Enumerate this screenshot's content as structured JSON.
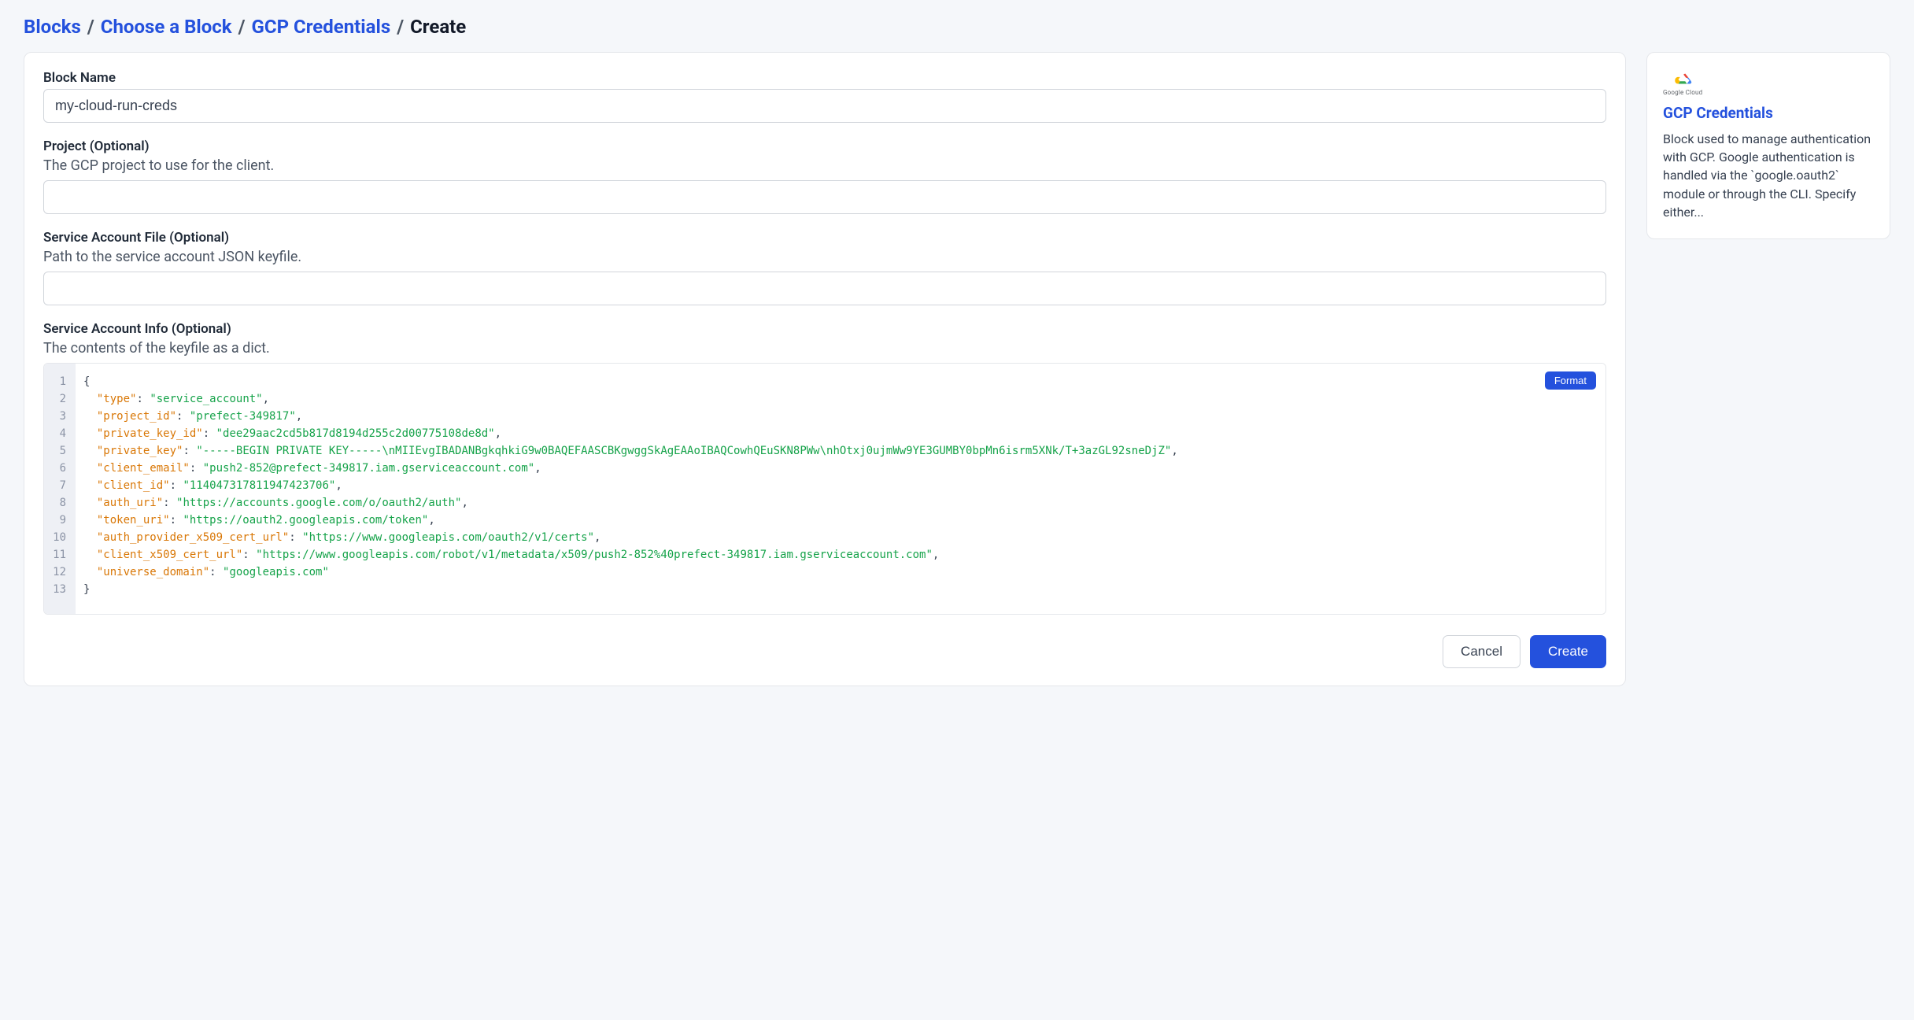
{
  "breadcrumb": {
    "blocks": "Blocks",
    "choose": "Choose a Block",
    "gcp": "GCP Credentials",
    "create": "Create"
  },
  "form": {
    "block_name": {
      "label": "Block Name",
      "value": "my-cloud-run-creds"
    },
    "project": {
      "label": "Project (Optional)",
      "desc": "The GCP project to use for the client.",
      "value": ""
    },
    "service_account_file": {
      "label": "Service Account File (Optional)",
      "desc": "Path to the service account JSON keyfile.",
      "value": ""
    },
    "service_account_info": {
      "label": "Service Account Info (Optional)",
      "desc": "The contents of the keyfile as a dict.",
      "format_button": "Format",
      "json": {
        "type": "service_account",
        "project_id": "prefect-349817",
        "private_key_id": "dee29aac2cd5b817d8194d255c2d00775108de8d",
        "private_key": "-----BEGIN PRIVATE KEY-----\\nMIIEvgIBADANBgkqhkiG9w0BAQEFAASCBKgwggSkAgEAAoIBAQCowhQEuSKN8PWw\\nhOtxj0ujmWw9YE3GUMBY0bpMn6isrm5XNk/T+3azGL92sneDjZ",
        "client_email": "push2-852@prefect-349817.iam.gserviceaccount.com",
        "client_id": "114047317811947423706",
        "auth_uri": "https://accounts.google.com/o/oauth2/auth",
        "token_uri": "https://oauth2.googleapis.com/token",
        "auth_provider_x509_cert_url": "https://www.googleapis.com/oauth2/v1/certs",
        "client_x509_cert_url": "https://www.googleapis.com/robot/v1/metadata/x509/push2-852%40prefect-349817.iam.gserviceaccount.com",
        "universe_domain": "googleapis.com"
      }
    }
  },
  "actions": {
    "cancel": "Cancel",
    "create": "Create"
  },
  "sidebar": {
    "logo_text": "Google Cloud",
    "title": "GCP Credentials",
    "description": "Block used to manage authentication with GCP. Google authentication is handled via the `google.oauth2` module or through the CLI. Specify either..."
  }
}
